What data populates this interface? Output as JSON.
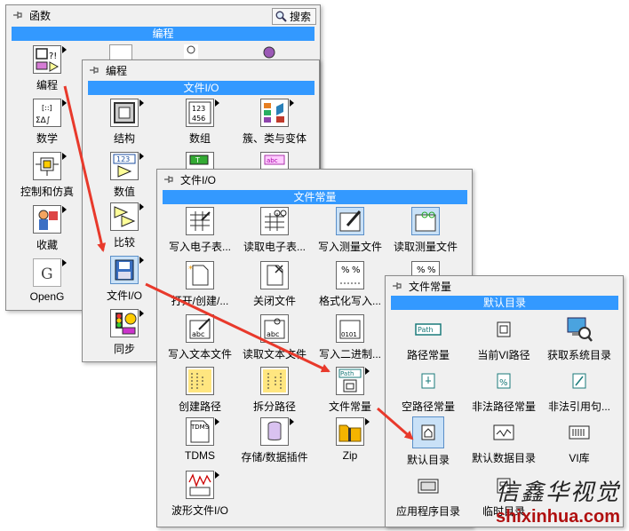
{
  "palettes": {
    "functions": {
      "title": "函数",
      "search_label": "搜索",
      "category": "编程",
      "items": [
        "编程",
        "数学",
        "控制和仿真",
        "收藏",
        "OpenG"
      ]
    },
    "programming": {
      "title": "编程",
      "category": "文件I/O",
      "items": [
        "结构",
        "数组",
        "簇、类与变体",
        "数值",
        "比较",
        "文件I/O",
        "同步"
      ]
    },
    "file_io": {
      "title": "文件I/O",
      "category": "文件常量",
      "items": [
        "写入电子表...",
        "读取电子表...",
        "写入测量文件",
        "读取测量文件",
        "打开/创建/...",
        "关闭文件",
        "格式化写入...",
        "写入文本文件",
        "读取文本文件",
        "写入二进制...",
        "创建路径",
        "拆分路径",
        "文件常量",
        "TDMS",
        "存储/数据插件",
        "Zip",
        "波形文件I/O"
      ]
    },
    "file_constants": {
      "title": "文件常量",
      "category": "默认目录",
      "items": [
        "路径常量",
        "当前VI路径",
        "获取系统目录",
        "空路径常量",
        "非法路径常量",
        "非法引用句...",
        "默认目录",
        "默认数据目录",
        "VI库",
        "应用程序目录",
        "临时目录"
      ]
    }
  },
  "icon_text": {
    "path_constant": "Path",
    "file_constant": "Path",
    "tdms": "TDMS",
    "numeric": "123"
  },
  "watermark": {
    "chinese": "信鑫华视觉",
    "url": "shixinhua.com"
  },
  "colors": {
    "category_bar": "#3399ff",
    "arrow": "#e8392b",
    "selected_icon": "#c9e1f7",
    "watermark_url": "#b01010"
  }
}
